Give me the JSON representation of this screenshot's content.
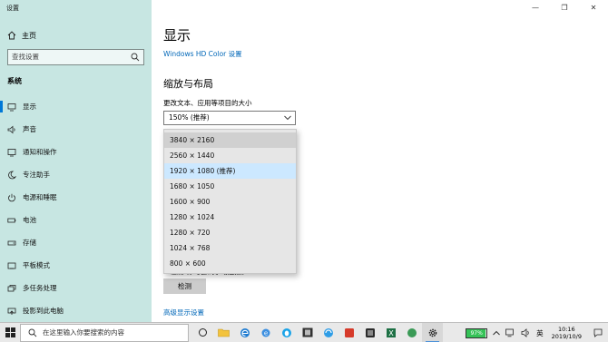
{
  "window": {
    "title": "设置",
    "minimize": "—",
    "maximize": "❐",
    "close": "✕"
  },
  "sidebar": {
    "home": "主页",
    "search_placeholder": "查找设置",
    "section": "系统",
    "items": [
      {
        "label": "显示",
        "icon": "monitor-icon"
      },
      {
        "label": "声音",
        "icon": "speaker-icon"
      },
      {
        "label": "通知和操作",
        "icon": "notification-icon"
      },
      {
        "label": "专注助手",
        "icon": "moon-icon"
      },
      {
        "label": "电源和睡眠",
        "icon": "power-icon"
      },
      {
        "label": "电池",
        "icon": "battery-icon"
      },
      {
        "label": "存储",
        "icon": "storage-icon"
      },
      {
        "label": "平板模式",
        "icon": "tablet-icon"
      },
      {
        "label": "多任务处理",
        "icon": "multitask-icon"
      },
      {
        "label": "投影到此电脑",
        "icon": "project-icon"
      }
    ]
  },
  "main": {
    "title": "显示",
    "hd_link": "Windows HD Color 设置",
    "scale_heading": "缩放与布局",
    "scale_label": "更改文本、应用等项目的大小",
    "scale_value": "150% (推荐)",
    "detect_text": "\"检测\"即可尝试手动连接。",
    "detect_button": "检测",
    "advanced_link": "高级显示设置"
  },
  "resolution_dropdown": {
    "options": [
      "3840 × 2160",
      "2560 × 1440",
      "1920 × 1080 (推荐)",
      "1680 × 1050",
      "1600 × 900",
      "1280 × 1024",
      "1280 × 720",
      "1024 × 768",
      "800 × 600"
    ],
    "selected_index": 2,
    "hover_index": 0
  },
  "taskbar": {
    "search_placeholder": "在这里输入你要搜索的内容",
    "battery_percent": "97%",
    "ime": "英",
    "time": "10:16",
    "date": "2019/10/9"
  },
  "colors": {
    "sidebar_bg": "#c7e6e2",
    "accent": "#0078d7",
    "link": "#0067b8",
    "selected_option": "#cce8ff"
  }
}
